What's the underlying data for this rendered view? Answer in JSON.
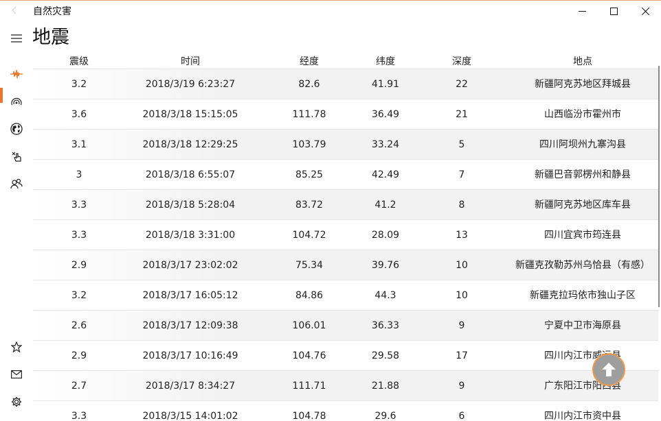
{
  "window": {
    "title": "自然灾害",
    "back_icon": "back-arrow-icon",
    "minimize_icon": "minimize-icon",
    "maximize_icon": "maximize-icon",
    "close_icon": "close-icon"
  },
  "page": {
    "title": "地震"
  },
  "nav": {
    "items": [
      {
        "name": "hamburger-menu-icon",
        "active": false
      },
      {
        "name": "earthquake-icon",
        "active": true
      },
      {
        "name": "broadcast-icon",
        "active": false
      },
      {
        "name": "globe-icon",
        "active": false
      },
      {
        "name": "hand-pointer-icon",
        "active": false
      },
      {
        "name": "people-icon",
        "active": false
      }
    ],
    "bottom": [
      {
        "name": "star-icon"
      },
      {
        "name": "mail-icon"
      },
      {
        "name": "gear-icon"
      }
    ],
    "accent_color": "#e8772e"
  },
  "table": {
    "headers": [
      "震级",
      "时间",
      "经度",
      "纬度",
      "深度",
      "地点"
    ],
    "rows": [
      [
        "3.2",
        "2018/3/19 6:23:27",
        "82.6",
        "41.91",
        "22",
        "新疆阿克苏地区拜城县"
      ],
      [
        "3.6",
        "2018/3/18 15:15:05",
        "111.78",
        "36.49",
        "21",
        "山西临汾市霍州市"
      ],
      [
        "3.1",
        "2018/3/18 12:29:25",
        "103.79",
        "33.24",
        "5",
        "四川阿坝州九寨沟县"
      ],
      [
        "3",
        "2018/3/18 6:55:07",
        "85.25",
        "42.49",
        "7",
        "新疆巴音郭楞州和静县"
      ],
      [
        "3.3",
        "2018/3/18 5:28:04",
        "83.72",
        "41.2",
        "8",
        "新疆阿克苏地区库车县"
      ],
      [
        "3.3",
        "2018/3/18 3:31:00",
        "104.72",
        "28.09",
        "13",
        "四川宜宾市筠连县"
      ],
      [
        "2.9",
        "2018/3/17 23:02:02",
        "75.34",
        "39.76",
        "10",
        "新疆克孜勒苏州乌恰县（有感）"
      ],
      [
        "3.2",
        "2018/3/17 16:05:12",
        "84.86",
        "44.3",
        "10",
        "新疆克拉玛依市独山子区"
      ],
      [
        "2.6",
        "2018/3/17 12:09:38",
        "106.01",
        "36.33",
        "9",
        "宁夏中卫市海原县"
      ],
      [
        "2.9",
        "2018/3/17 10:16:49",
        "104.76",
        "29.58",
        "17",
        "四川内江市威远县"
      ],
      [
        "2.7",
        "2018/3/17 8:34:27",
        "111.71",
        "21.88",
        "9",
        "广东阳江市阳西县"
      ],
      [
        "3.3",
        "2018/3/15 14:01:02",
        "104.78",
        "29.6",
        "6",
        "四川内江市资中县"
      ]
    ]
  },
  "fab": {
    "icon": "arrow-up-icon",
    "border_color": "#f29a4a"
  }
}
